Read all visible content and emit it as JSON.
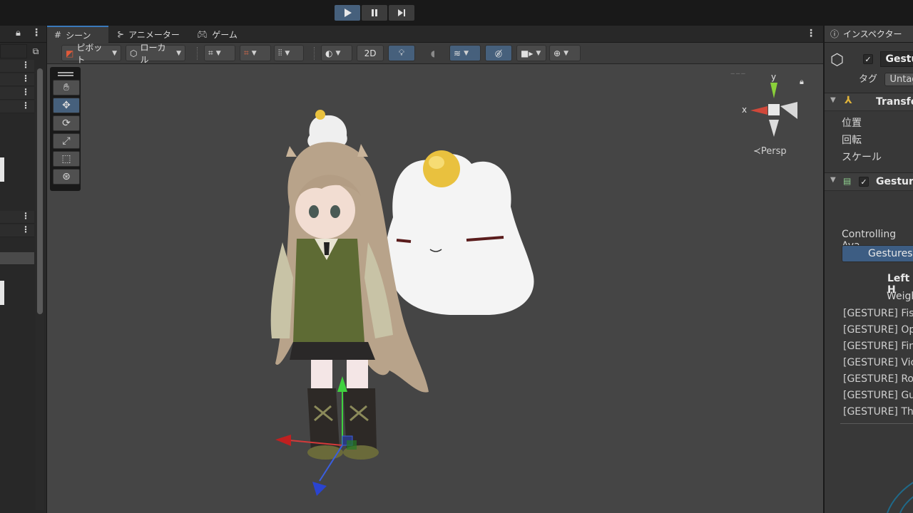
{
  "playbar": {
    "play": "play",
    "pause": "pause",
    "step": "step"
  },
  "hierarchy": {
    "lock": "lock",
    "menu": "⋮"
  },
  "scene_tabs": [
    {
      "label": "シーン",
      "icon": "grid-icon"
    },
    {
      "label": "アニメーター",
      "icon": "animator-icon"
    },
    {
      "label": "ゲーム",
      "icon": "gamepad-icon"
    }
  ],
  "toolbar": {
    "pivot_label": "ピボット",
    "local_label": "ローカル",
    "mode_2d": "2D"
  },
  "viewport": {
    "gizmo_persp": "≺Persp",
    "axis_y": "y",
    "axis_x": "x"
  },
  "inspector": {
    "tab_label": "インスペクター",
    "object_name": "Gestu",
    "tag_label": "タグ",
    "tag_value": "Untag",
    "transform_title": "Transfo",
    "position_label": "位置",
    "rotation_label": "回転",
    "scale_label": "スケール",
    "script_title": "Gesture",
    "controlling_label": "Controlling Ava",
    "gestures_button": "Gestures",
    "left_label": "Left H",
    "weight_label": "Weigh",
    "gestures": [
      "[GESTURE] Fis",
      "[GESTURE] Op",
      "[GESTURE] Fin",
      "[GESTURE] Vic",
      "[GESTURE] Ro",
      "[GESTURE] Gu",
      "[GESTURE] Th"
    ]
  },
  "colors": {
    "accent": "#46607c",
    "viewport_bg": "#454545",
    "panel_bg": "#383838"
  }
}
